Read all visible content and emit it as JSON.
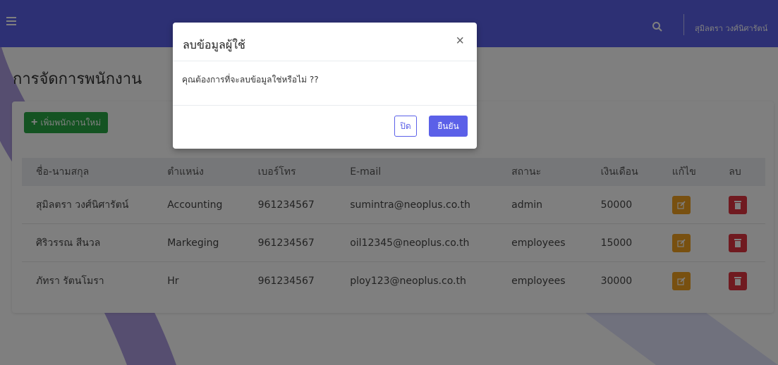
{
  "header": {
    "user_name": "สุมิลตรา วงศ์นิศารัตน์",
    "accent_color": "#5b60e8"
  },
  "page": {
    "title": "การจัดการพนักงาน",
    "add_button_label": "เพิ่มพนักงานใหม่"
  },
  "table": {
    "columns": [
      "ชื่อ-นามสกุล",
      "ตำแหน่ง",
      "เบอร์โทร",
      "E-mail",
      "สถานะ",
      "เงินเดือน",
      "แก้ไข",
      "ลบ"
    ],
    "rows": [
      {
        "name": "สุมิลตรา วงศ์นิศารัตน์",
        "position": "Accounting",
        "phone": "961234567",
        "email": "sumintra@neoplus.co.th",
        "status": "admin",
        "salary": "50000"
      },
      {
        "name": "ศิริวรรณ สีนวล",
        "position": "Markeging",
        "phone": "961234567",
        "email": "oil12345@neoplus.co.th",
        "status": "employees",
        "salary": "15000"
      },
      {
        "name": "ภัทรา รัตนโมรา",
        "position": "Hr",
        "phone": "961234567",
        "email": "ploy123@neoplus.co.th",
        "status": "employees",
        "salary": "30000"
      }
    ]
  },
  "modal": {
    "title": "ลบข้อมูลผู้ใช้",
    "close_symbol": "×",
    "body": "คุณต้องการที่จะลบข้อมูลใช่หรือไม่ ??",
    "cancel_label": "ปิด",
    "confirm_label": "ยืนยัน"
  },
  "icons": {
    "menu": "hamburger-icon",
    "search": "search-icon",
    "edit": "edit-icon",
    "delete": "trash-icon",
    "add": "plus-icon"
  },
  "colors": {
    "edit": "#f0a020",
    "delete": "#e03540",
    "add": "#28a745"
  }
}
